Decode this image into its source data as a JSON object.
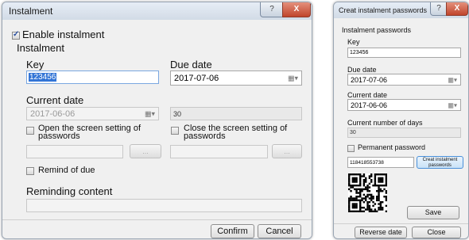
{
  "win1": {
    "title": "Instalment",
    "help_label": "?",
    "close_label": "X",
    "enable_label": "Enable instalment",
    "group_label": "Instalment",
    "key_label": "Key",
    "key_value": "123456",
    "due_label": "Due date",
    "due_value": "2017-07-06",
    "current_label": "Current date",
    "current_value": "2017-06-06",
    "days_value": "30",
    "open_screen_label": "Open the screen setting of\npasswords",
    "close_screen_label": "Close the screen setting of\npasswords",
    "ellipsis": "...",
    "remind_label": "Remind of due",
    "reminding_label": "Reminding content",
    "confirm": "Confirm",
    "cancel": "Cancel"
  },
  "win2": {
    "title": "Creat instalment passwords",
    "help_label": "?",
    "close_label": "X",
    "section": "Instalment passwords",
    "key_label": "Key",
    "key_value": "123456",
    "due_label": "Due date",
    "due_value": "2017-07-06",
    "current_label": "Current date",
    "current_value": "2017-06-06",
    "days_label": "Current number of days",
    "days_value": "30",
    "permanent_label": "Permanent password",
    "password_value": "118418553738",
    "creat_button": "Creat instalment passwords",
    "save": "Save",
    "reverse": "Reverse date",
    "close": "Close"
  },
  "colors": {
    "accent_selection": "#3375d6",
    "dialog_bg": "#f0f0f0",
    "close_button": "#c0452c"
  },
  "icons": {
    "calendar": "calendar-icon",
    "dropdown": "chevron-down-icon",
    "qr": "qr-code-icon"
  }
}
